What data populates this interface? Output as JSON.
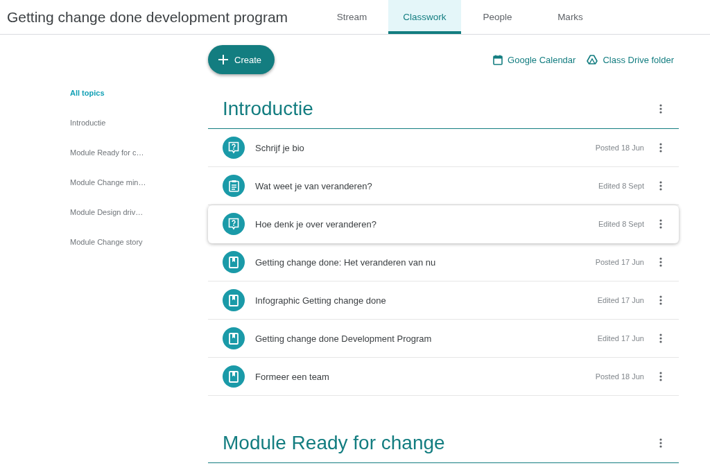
{
  "header": {
    "title": "Getting change done development program",
    "tabs": [
      {
        "label": "Stream",
        "selected": false
      },
      {
        "label": "Classwork",
        "selected": true
      },
      {
        "label": "People",
        "selected": false
      },
      {
        "label": "Marks",
        "selected": false
      }
    ]
  },
  "sidebar": {
    "items": [
      {
        "label": "All topics",
        "selected": true
      },
      {
        "label": "Introductie",
        "selected": false
      },
      {
        "label": "Module Ready for c…",
        "selected": false
      },
      {
        "label": "Module Change min…",
        "selected": false
      },
      {
        "label": "Module Design driv…",
        "selected": false
      },
      {
        "label": "Module Change story",
        "selected": false
      }
    ]
  },
  "toolbar": {
    "create_button": "Create",
    "links": [
      {
        "kind": "calendar",
        "label": "Google Calendar"
      },
      {
        "kind": "drive",
        "label": "Class Drive folder"
      }
    ]
  },
  "topics": [
    {
      "title": "Introductie",
      "items": [
        {
          "kind": "question",
          "title": "Schrijf je bio",
          "status": "Posted 18 Jun",
          "selected": false
        },
        {
          "kind": "assignment",
          "title": "Wat weet je van veranderen?",
          "status": "Edited 8 Sept",
          "selected": false
        },
        {
          "kind": "question",
          "title": "Hoe denk je over veranderen?",
          "status": "Edited 8 Sept",
          "selected": true
        },
        {
          "kind": "material",
          "title": "Getting change done: Het veranderen van nu",
          "status": "Posted 17 Jun",
          "selected": false
        },
        {
          "kind": "material",
          "title": "Infographic Getting change done",
          "status": "Edited 17 Jun",
          "selected": false
        },
        {
          "kind": "material",
          "title": "Getting change done Development Program",
          "status": "Edited 17 Jun",
          "selected": false
        },
        {
          "kind": "material",
          "title": "Formeer een team",
          "status": "Posted 18 Jun",
          "selected": false
        }
      ]
    },
    {
      "title": "Module Ready for change"
    }
  ]
}
